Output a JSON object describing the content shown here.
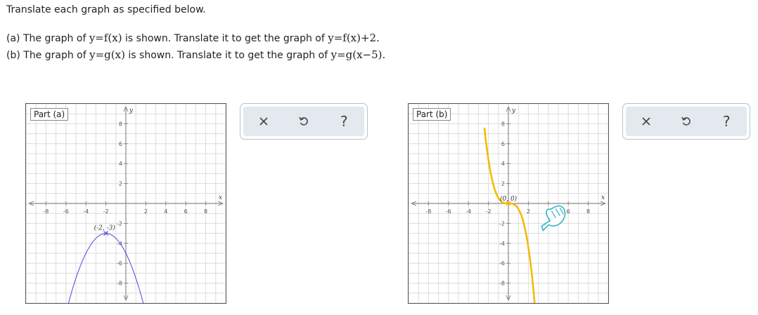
{
  "instructions": "Translate each graph as specified below.",
  "problems": [
    {
      "prefix": "(a) The graph of ",
      "given": "y=f(x)",
      "mid": " is shown. Translate it to get the graph of ",
      "target": "y=f(x)+2."
    },
    {
      "prefix": "(b) The graph of ",
      "given": "y=g(x)",
      "mid": " is shown. Translate it to get the graph of ",
      "target": "y=g(x−5)."
    }
  ],
  "parts": [
    {
      "label": "Part (a)",
      "axis_x_label": "x",
      "axis_y_label": "y",
      "point_label": "(-2, -3)",
      "curve_color": "#4a4ae0",
      "curve": "parabola",
      "vertex": [
        -2,
        -3
      ]
    },
    {
      "label": "Part (b)",
      "axis_x_label": "x",
      "axis_y_label": "y",
      "point_label": "(0, 0)",
      "curve_color": "#f5b800",
      "curve": "cubic",
      "point": [
        0,
        0
      ]
    }
  ],
  "ticks": {
    "x": [
      "-8",
      "-6",
      "-4",
      "-2",
      "2",
      "4",
      "6",
      "8"
    ],
    "y": [
      "8",
      "6",
      "4",
      "2",
      "-2",
      "-4",
      "-6",
      "-8"
    ]
  },
  "toolbar": {
    "clear_icon": "close-icon",
    "undo_icon": "undo-icon",
    "help_label": "?"
  },
  "colors": {
    "grid": "#dcdcdc",
    "axis": "#8a8a8a",
    "cursor": "#36b3c7"
  }
}
